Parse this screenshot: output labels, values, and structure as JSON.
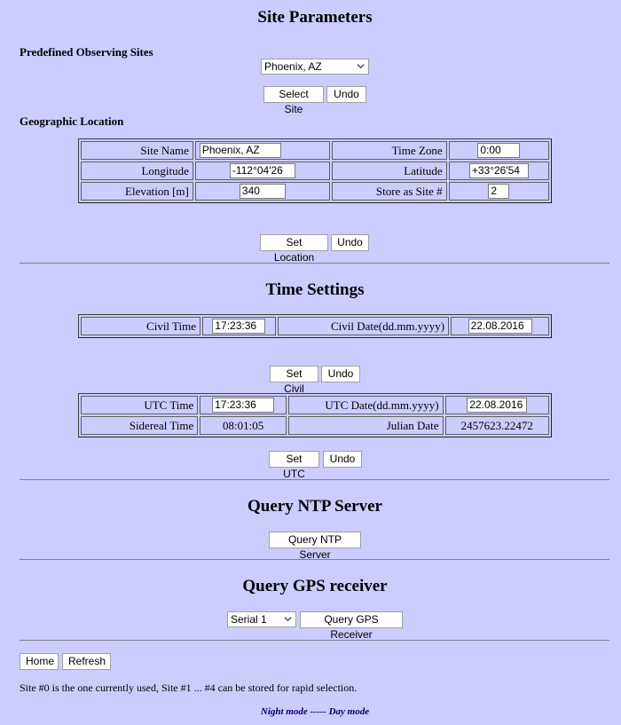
{
  "site_params": {
    "title": "Site Parameters",
    "predefined_heading": "Predefined Observing Sites",
    "site_select_value": "Phoenix, AZ",
    "select_site_label": "Select Site",
    "undo_label": "Undo"
  },
  "geo": {
    "heading": "Geographic Location",
    "site_name_label": "Site Name",
    "site_name_value": "Phoenix, AZ",
    "time_zone_label": "Time Zone",
    "time_zone_value": "0:00",
    "longitude_label": "Longitude",
    "longitude_value": "-112°04'26",
    "latitude_label": "Latitude",
    "latitude_value": "+33°26'54",
    "elevation_label": "Elevation [m]",
    "elevation_value": "340",
    "store_label": "Store as Site #",
    "store_value": "2",
    "set_location_label": "Set Location",
    "undo_label": "Undo"
  },
  "time": {
    "title": "Time Settings",
    "civil_time_label": "Civil Time",
    "civil_time_value": "17:23:36",
    "civil_date_label": "Civil Date(dd.mm.yyyy)",
    "civil_date_value": "22.08.2016",
    "set_civil_label": "Set Civil",
    "undo_label": "Undo",
    "utc_time_label": "UTC Time",
    "utc_time_value": "17:23:36",
    "utc_date_label": "UTC Date(dd.mm.yyyy)",
    "utc_date_value": "22.08.2016",
    "sidereal_label": "Sidereal Time",
    "sidereal_value": "08:01:05",
    "julian_label": "Julian Date",
    "julian_value": "2457623.22472",
    "set_utc_label": "Set UTC",
    "undo2_label": "Undo"
  },
  "ntp": {
    "title": "Query NTP Server",
    "button_label": "Query NTP Server"
  },
  "gps": {
    "title": "Query GPS receiver",
    "port_value": "Serial 1",
    "button_label": "Query GPS Receiver"
  },
  "footer": {
    "home_label": "Home",
    "refresh_label": "Refresh",
    "note": "Site #0 is the one currently used, Site #1 ... #4 can be stored for rapid selection.",
    "night_mode": "Night mode",
    "separator": " ----- ",
    "day_mode": "Day mode"
  }
}
